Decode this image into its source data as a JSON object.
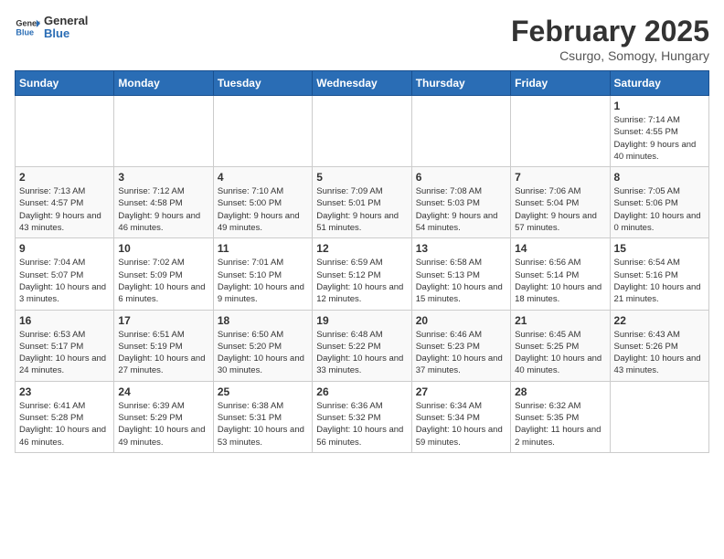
{
  "header": {
    "logo_line1": "General",
    "logo_line2": "Blue",
    "month": "February 2025",
    "location": "Csurgo, Somogy, Hungary"
  },
  "weekdays": [
    "Sunday",
    "Monday",
    "Tuesday",
    "Wednesday",
    "Thursday",
    "Friday",
    "Saturday"
  ],
  "weeks": [
    [
      {
        "day": "",
        "info": ""
      },
      {
        "day": "",
        "info": ""
      },
      {
        "day": "",
        "info": ""
      },
      {
        "day": "",
        "info": ""
      },
      {
        "day": "",
        "info": ""
      },
      {
        "day": "",
        "info": ""
      },
      {
        "day": "1",
        "info": "Sunrise: 7:14 AM\nSunset: 4:55 PM\nDaylight: 9 hours and 40 minutes."
      }
    ],
    [
      {
        "day": "2",
        "info": "Sunrise: 7:13 AM\nSunset: 4:57 PM\nDaylight: 9 hours and 43 minutes."
      },
      {
        "day": "3",
        "info": "Sunrise: 7:12 AM\nSunset: 4:58 PM\nDaylight: 9 hours and 46 minutes."
      },
      {
        "day": "4",
        "info": "Sunrise: 7:10 AM\nSunset: 5:00 PM\nDaylight: 9 hours and 49 minutes."
      },
      {
        "day": "5",
        "info": "Sunrise: 7:09 AM\nSunset: 5:01 PM\nDaylight: 9 hours and 51 minutes."
      },
      {
        "day": "6",
        "info": "Sunrise: 7:08 AM\nSunset: 5:03 PM\nDaylight: 9 hours and 54 minutes."
      },
      {
        "day": "7",
        "info": "Sunrise: 7:06 AM\nSunset: 5:04 PM\nDaylight: 9 hours and 57 minutes."
      },
      {
        "day": "8",
        "info": "Sunrise: 7:05 AM\nSunset: 5:06 PM\nDaylight: 10 hours and 0 minutes."
      }
    ],
    [
      {
        "day": "9",
        "info": "Sunrise: 7:04 AM\nSunset: 5:07 PM\nDaylight: 10 hours and 3 minutes."
      },
      {
        "day": "10",
        "info": "Sunrise: 7:02 AM\nSunset: 5:09 PM\nDaylight: 10 hours and 6 minutes."
      },
      {
        "day": "11",
        "info": "Sunrise: 7:01 AM\nSunset: 5:10 PM\nDaylight: 10 hours and 9 minutes."
      },
      {
        "day": "12",
        "info": "Sunrise: 6:59 AM\nSunset: 5:12 PM\nDaylight: 10 hours and 12 minutes."
      },
      {
        "day": "13",
        "info": "Sunrise: 6:58 AM\nSunset: 5:13 PM\nDaylight: 10 hours and 15 minutes."
      },
      {
        "day": "14",
        "info": "Sunrise: 6:56 AM\nSunset: 5:14 PM\nDaylight: 10 hours and 18 minutes."
      },
      {
        "day": "15",
        "info": "Sunrise: 6:54 AM\nSunset: 5:16 PM\nDaylight: 10 hours and 21 minutes."
      }
    ],
    [
      {
        "day": "16",
        "info": "Sunrise: 6:53 AM\nSunset: 5:17 PM\nDaylight: 10 hours and 24 minutes."
      },
      {
        "day": "17",
        "info": "Sunrise: 6:51 AM\nSunset: 5:19 PM\nDaylight: 10 hours and 27 minutes."
      },
      {
        "day": "18",
        "info": "Sunrise: 6:50 AM\nSunset: 5:20 PM\nDaylight: 10 hours and 30 minutes."
      },
      {
        "day": "19",
        "info": "Sunrise: 6:48 AM\nSunset: 5:22 PM\nDaylight: 10 hours and 33 minutes."
      },
      {
        "day": "20",
        "info": "Sunrise: 6:46 AM\nSunset: 5:23 PM\nDaylight: 10 hours and 37 minutes."
      },
      {
        "day": "21",
        "info": "Sunrise: 6:45 AM\nSunset: 5:25 PM\nDaylight: 10 hours and 40 minutes."
      },
      {
        "day": "22",
        "info": "Sunrise: 6:43 AM\nSunset: 5:26 PM\nDaylight: 10 hours and 43 minutes."
      }
    ],
    [
      {
        "day": "23",
        "info": "Sunrise: 6:41 AM\nSunset: 5:28 PM\nDaylight: 10 hours and 46 minutes."
      },
      {
        "day": "24",
        "info": "Sunrise: 6:39 AM\nSunset: 5:29 PM\nDaylight: 10 hours and 49 minutes."
      },
      {
        "day": "25",
        "info": "Sunrise: 6:38 AM\nSunset: 5:31 PM\nDaylight: 10 hours and 53 minutes."
      },
      {
        "day": "26",
        "info": "Sunrise: 6:36 AM\nSunset: 5:32 PM\nDaylight: 10 hours and 56 minutes."
      },
      {
        "day": "27",
        "info": "Sunrise: 6:34 AM\nSunset: 5:34 PM\nDaylight: 10 hours and 59 minutes."
      },
      {
        "day": "28",
        "info": "Sunrise: 6:32 AM\nSunset: 5:35 PM\nDaylight: 11 hours and 2 minutes."
      },
      {
        "day": "",
        "info": ""
      }
    ]
  ]
}
